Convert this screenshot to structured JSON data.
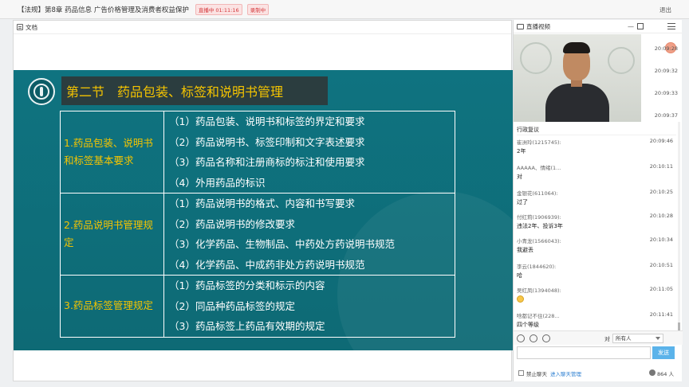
{
  "window": {
    "title": "【法规】第8章 药品信息 广告价格管理及消费者权益保护",
    "live_badge": "直播中 01:11:16",
    "rec_badge": "录制中",
    "exit_label": "退出"
  },
  "doc": {
    "tab_label": "文档"
  },
  "slide": {
    "section_title": "第二节　药品包装、标签和说明书管理",
    "rows": [
      {
        "category": "1.药品包装、说明书和标签基本要求",
        "items": [
          "（1）药品包装、说明书和标签的界定和要求",
          "（2）药品说明书、标签印制和文字表述要求",
          "（3）药品名称和注册商标的标注和使用要求",
          "（4）外用药品的标识"
        ]
      },
      {
        "category": "2.药品说明书管理规定",
        "items": [
          "（1）药品说明书的格式、内容和书写要求",
          "（2）药品说明书的修改要求",
          "（3）化学药品、生物制品、中药处方药说明书规范",
          "（4）化学药品、中成药非处方药说明书规范"
        ]
      },
      {
        "category": "3.药品标签管理规定",
        "items": [
          "（1）药品标签的分类和标示的内容",
          "（2）同品种药品标签的规定",
          "（3）药品标签上药品有效期的规定"
        ]
      }
    ]
  },
  "video": {
    "header_label": "直播视频",
    "times": [
      "20:09:28",
      "20:09:32",
      "20:09:33",
      "20:09:37"
    ]
  },
  "chat": {
    "first_text": "行政复议",
    "messages": [
      {
        "sender": "崔洲玲(1215745):",
        "time": "20:09:46",
        "text": "2年"
      },
      {
        "sender": "AAAAA、情绪(1...",
        "time": "20:10:11",
        "text": "对"
      },
      {
        "sender": "金银花(611064):",
        "time": "20:10:25",
        "text": "过了"
      },
      {
        "sender": "付红莉(1906939):",
        "time": "20:10:28",
        "text": "违法2年、投诉3年"
      },
      {
        "sender": "小青龙(1566043):",
        "time": "20:10:34",
        "text": "我避丢"
      },
      {
        "sender": "李云(1844620):",
        "time": "20:10:51",
        "text": "哈"
      },
      {
        "sender": "吴红凤(1394048):",
        "time": "20:11:05",
        "text": ""
      },
      {
        "sender": "啥都记不住(228...",
        "time": "20:11:41",
        "text": "四个等级"
      }
    ],
    "to_label": "对",
    "to_value": "所有人",
    "input_placeholder": "",
    "send_label": "发送",
    "ban_label": "禁止聊天",
    "room_link": "进入聊天管理",
    "people_count": "864 人"
  }
}
